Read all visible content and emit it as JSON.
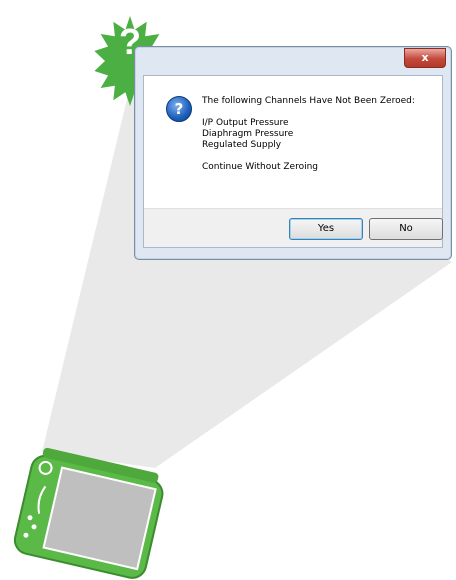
{
  "badge": {
    "glyph": "?"
  },
  "dialog": {
    "close_label": "x",
    "icon_glyph": "?",
    "heading": "The following Channels Have Not Been Zeroed:",
    "channels": [
      "I/P Output Pressure",
      "Diaphragm Pressure",
      "Regulated Supply"
    ],
    "question": "Continue Without Zeroing",
    "yes_label": "Yes",
    "no_label": "No"
  },
  "colors": {
    "device_green": "#5ab947",
    "badge_green": "#4caf43",
    "beam_gray": "#e9e9e9",
    "window_frame": "#dfe8f2",
    "close_red": "#c4493a"
  }
}
